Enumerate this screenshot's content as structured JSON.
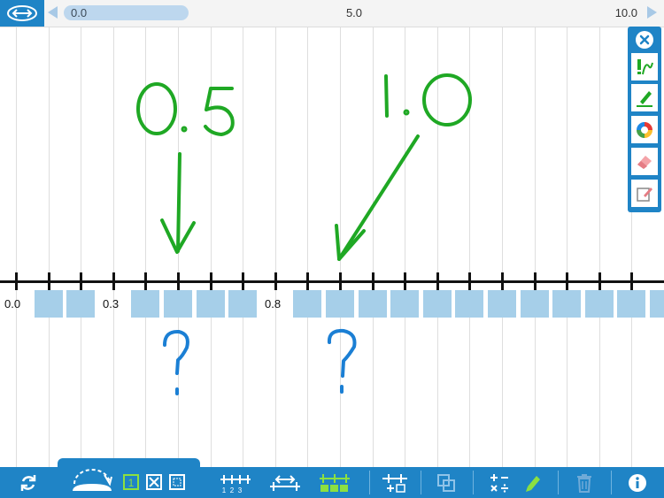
{
  "top_scale": {
    "left_value": "0.0",
    "middle_value": "5.0",
    "right_value": "10.0"
  },
  "number_line": {
    "labels": [
      {
        "text": "0.0",
        "value": 0.0
      },
      {
        "text": "0.3",
        "value": 0.3
      },
      {
        "text": "0.8",
        "value": 0.8
      }
    ],
    "hidden_label_boxes": 16
  },
  "annotations": {
    "written": [
      "0.5",
      "1.0"
    ],
    "questions": [
      "?",
      "?"
    ]
  },
  "palette": {
    "tools": [
      "close-icon",
      "pen-icon",
      "highlighter-icon",
      "color-wheel-icon",
      "eraser-icon",
      "clear-page-icon"
    ]
  },
  "toolbar": {
    "tools": [
      "refresh-icon",
      "jump-arc-icon",
      "show-value-icon",
      "hide-value-icon",
      "outline-value-icon",
      "tick-marks-icon",
      "interval-icon",
      "hide-labels-icon",
      "add-bar-icon",
      "group-icon",
      "operations-icon",
      "marker-icon",
      "trash-icon",
      "info-icon"
    ]
  },
  "colors": {
    "accent": "#1f84c6",
    "cover": "#a6cfe9",
    "green_ink": "#1fa824",
    "blue_ink": "#1b7fd4",
    "active_toggle": "#8ce040"
  }
}
